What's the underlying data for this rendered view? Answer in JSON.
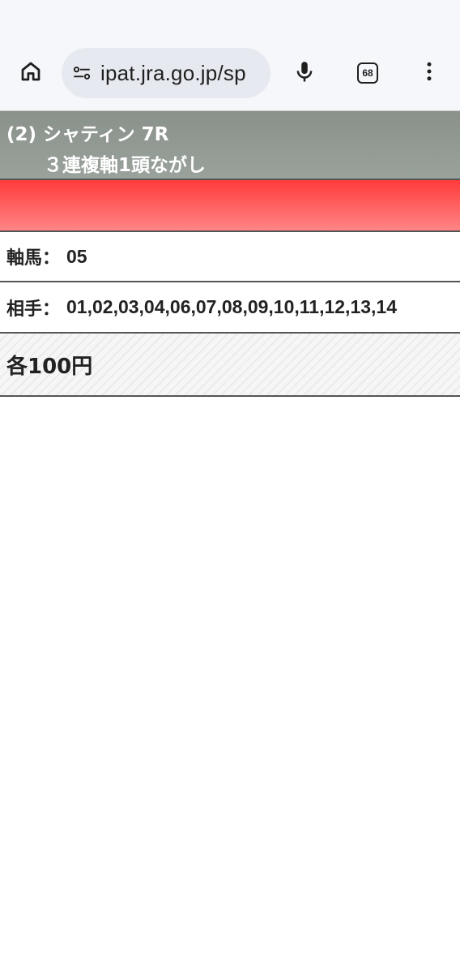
{
  "browser": {
    "url": "ipat.jra.go.jp/sp",
    "tab_count": "68",
    "icons": {
      "home": "home-icon",
      "site_settings": "tune-icon",
      "mic": "mic-icon",
      "tabs": "tab-switcher-icon",
      "menu": "more-vert-icon"
    }
  },
  "race": {
    "title": "(2) シャティン 7R",
    "bet_type": "３連複軸1頭ながし"
  },
  "selection": {
    "axis_label": "軸馬：",
    "axis_value": "05",
    "partner_label": "相手：",
    "partner_value": "01,02,03,04,06,07,08,09,10,11,12,13,14"
  },
  "amount": {
    "text": "各100円"
  },
  "colors": {
    "header_bg": "#8f9690",
    "accent_red": "#ff4a4a"
  }
}
